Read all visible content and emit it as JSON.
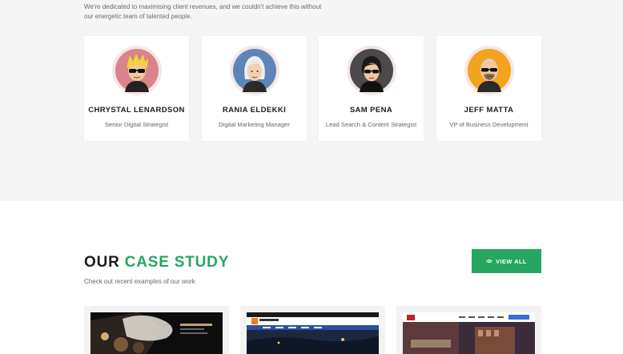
{
  "team": {
    "intro": "We're dedicated to maximising client revenues, and we couldn't achieve this without our energetic team of talented people.",
    "members": [
      {
        "name": "CHRYSTAL LENARDSON",
        "role": "Senior Digital Strategist",
        "avatar_icon": "avatar-blonde-sunglasses-icon"
      },
      {
        "name": "RANIA ELDEKKI",
        "role": "Digital Marketing Manager",
        "avatar_icon": "avatar-white-hair-icon"
      },
      {
        "name": "SAM PENA",
        "role": "Lead Search & Content Strategist",
        "avatar_icon": "avatar-dark-hair-sunglasses-icon"
      },
      {
        "name": "JEFF MATTA",
        "role": "VP of Business Development",
        "avatar_icon": "avatar-bald-sunglasses-icon"
      }
    ]
  },
  "case_study": {
    "title_part1": "OUR",
    "title_part2": "CASE STUDY",
    "subtitle": "Check out recent examples of our work",
    "view_all_label": "VIEW ALL",
    "view_all_icon": "eye-icon"
  },
  "colors": {
    "accent": "#26a660",
    "section_bg": "#f5f5f5"
  }
}
